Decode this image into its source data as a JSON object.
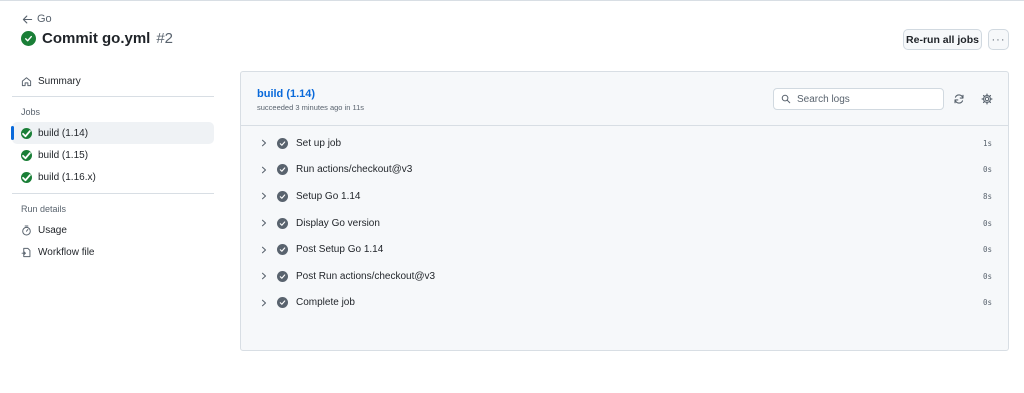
{
  "header": {
    "back_label": "Go",
    "title": "Commit go.yml",
    "run_number": "#2",
    "rerun_label": "Re-run all jobs",
    "more_label": "···"
  },
  "sidebar": {
    "summary_label": "Summary",
    "jobs_heading": "Jobs",
    "jobs": [
      {
        "label": "build (1.14)",
        "active": true
      },
      {
        "label": "build (1.15)",
        "active": false
      },
      {
        "label": "build (1.16.x)",
        "active": false
      }
    ],
    "run_details_heading": "Run details",
    "usage_label": "Usage",
    "workflow_file_label": "Workflow file"
  },
  "job": {
    "title": "build (1.14)",
    "subtitle": "succeeded 3 minutes ago in 11s",
    "search_placeholder": "Search logs",
    "steps": [
      {
        "name": "Set up job",
        "duration": "1s"
      },
      {
        "name": "Run actions/checkout@v3",
        "duration": "0s"
      },
      {
        "name": "Setup Go 1.14",
        "duration": "8s"
      },
      {
        "name": "Display Go version",
        "duration": "0s"
      },
      {
        "name": "Post Setup Go 1.14",
        "duration": "0s"
      },
      {
        "name": "Post Run actions/checkout@v3",
        "duration": "0s"
      },
      {
        "name": "Complete job",
        "duration": "0s"
      }
    ]
  },
  "colors": {
    "success": "#1a7f37",
    "link": "#0969da",
    "muted": "#59636e",
    "panel_bg": "#f6f8fa"
  },
  "icons": [
    "arrow-left-icon",
    "check-circle-icon",
    "home-icon",
    "stopwatch-icon",
    "workflow-file-icon",
    "search-icon",
    "sync-icon",
    "gear-icon",
    "chevron-right-icon",
    "kebab-horizontal-icon"
  ]
}
